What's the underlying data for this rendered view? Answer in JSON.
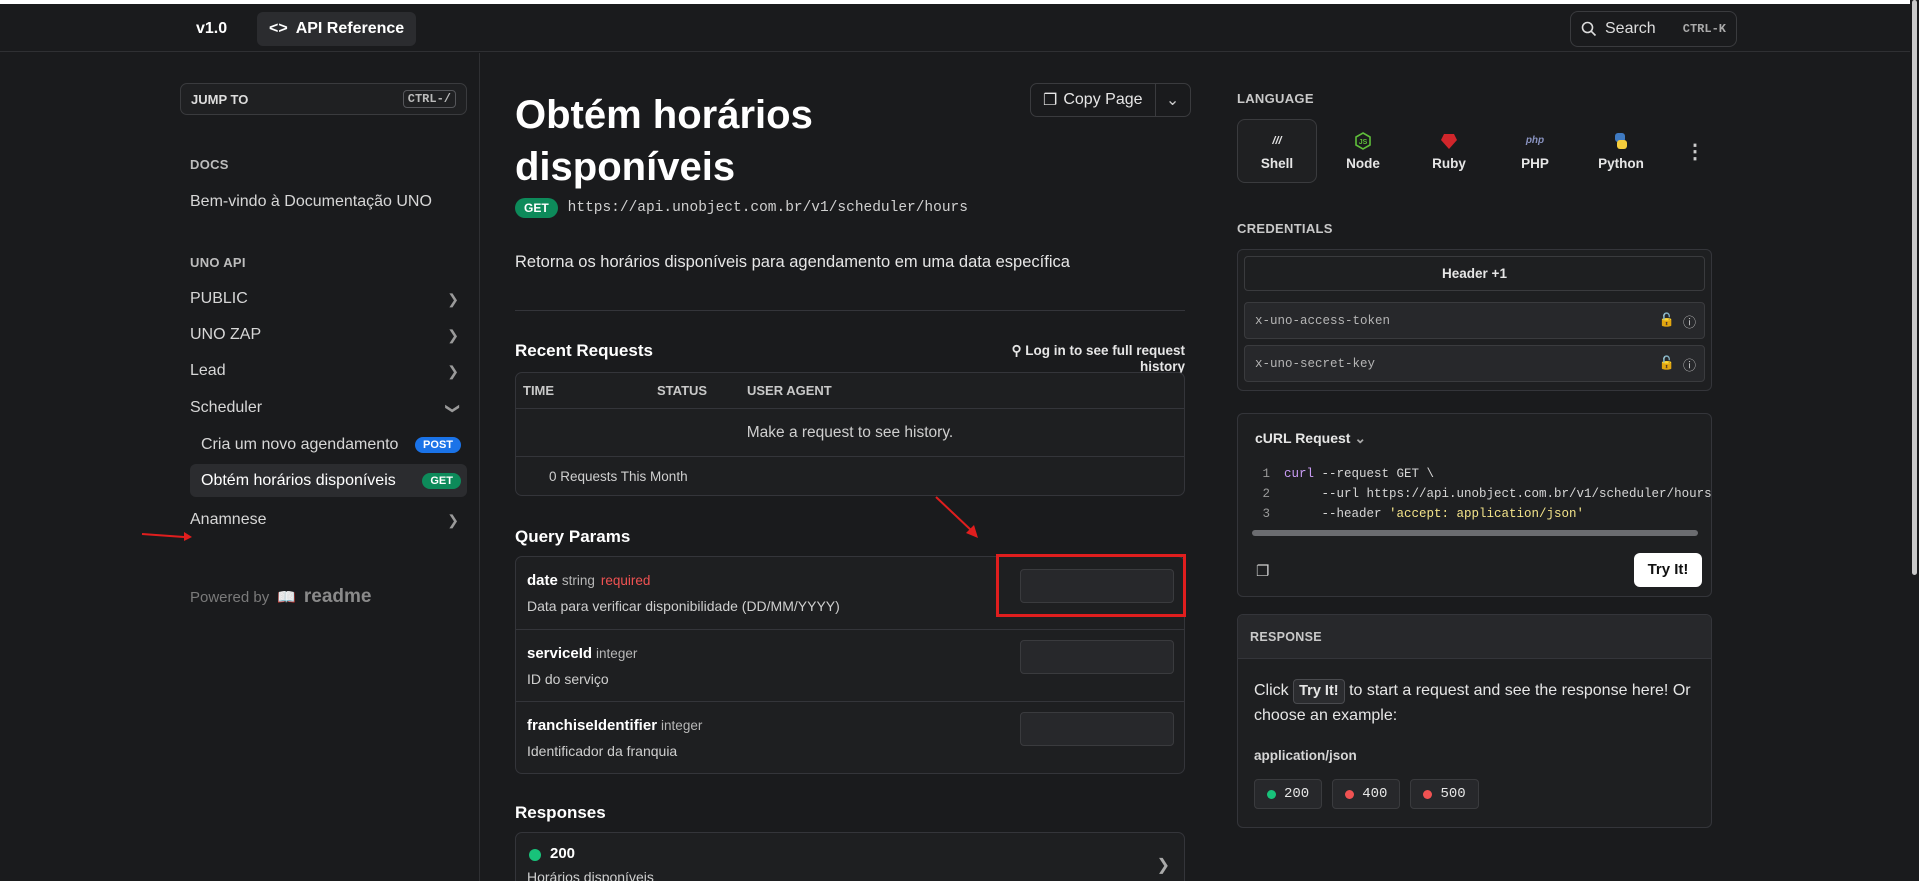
{
  "topbar": {
    "version": "v1.0",
    "api_reference": "API Reference",
    "search_label": "Search",
    "search_shortcut": "CTRL-K"
  },
  "sidebar": {
    "jump_to": "JUMP TO",
    "jump_shortcut": "CTRL-/",
    "docs_label": "DOCS",
    "docs_items": [
      "Bem-vindo à Documentação UNO"
    ],
    "api_label": "UNO API",
    "groups": [
      {
        "label": "PUBLIC"
      },
      {
        "label": "UNO ZAP"
      },
      {
        "label": "Lead"
      },
      {
        "label": "Scheduler"
      },
      {
        "label": "Anamnese"
      }
    ],
    "scheduler_items": [
      {
        "label": "Cria um novo agendamento",
        "method": "POST"
      },
      {
        "label": "Obtém horários disponíveis",
        "method": "GET"
      }
    ],
    "powered_by": "Powered by",
    "powered_brand": "readme"
  },
  "page": {
    "title": "Obtém horários disponíveis",
    "copy_page": "Copy Page",
    "method": "GET",
    "url": "https://api.unobject.com.br/v1/scheduler/hours",
    "description": "Retorna os horários disponíveis para agendamento em uma data específica"
  },
  "recent_requests": {
    "heading": "Recent Requests",
    "login_link": "Log in to see full request history",
    "columns": [
      "TIME",
      "STATUS",
      "USER AGENT"
    ],
    "empty_text": "Make a request to see history.",
    "footer": "0 Requests This Month"
  },
  "query_params": {
    "heading": "Query Params",
    "params": [
      {
        "name": "date",
        "type": "string",
        "required": "required",
        "description": "Data para verificar disponibilidade (DD/MM/YYYY)"
      },
      {
        "name": "serviceId",
        "type": "integer",
        "required": "",
        "description": "ID do serviço"
      },
      {
        "name": "franchiseIdentifier",
        "type": "integer",
        "required": "",
        "description": "Identificador da franquia"
      }
    ]
  },
  "responses": {
    "heading": "Responses",
    "items": [
      {
        "code": "200",
        "description": "Horários disponíveis"
      }
    ]
  },
  "right_panel": {
    "language_label": "LANGUAGE",
    "languages": [
      "Shell",
      "Node",
      "Ruby",
      "PHP",
      "Python"
    ],
    "selected_language": "Shell",
    "credentials_label": "CREDENTIALS",
    "credentials_header": "Header +1",
    "credential_fields": [
      "x-uno-access-token",
      "x-uno-secret-key"
    ],
    "curl_title": "cURL Request",
    "code_lines": [
      {
        "n": "1",
        "a": "curl",
        "b": " --request GET \\"
      },
      {
        "n": "2",
        "a": "",
        "b": "     --url https://api.unobject.com.br/v1/scheduler/hours"
      },
      {
        "n": "3",
        "a": "",
        "b": "     --header ",
        "s": "'accept: application/json'"
      }
    ],
    "try_it": "Try It!",
    "response_label": "RESPONSE",
    "response_text_1": "Click",
    "response_text_btn": "Try It!",
    "response_text_2": "to start a request and see the response here! Or choose an example:",
    "mime": "application/json",
    "examples": [
      {
        "code": "200",
        "color": "#18c27a"
      },
      {
        "code": "400",
        "color": "#f05252"
      },
      {
        "code": "500",
        "color": "#f05252"
      }
    ]
  },
  "colors": {
    "accent_get": "#0d8a5a",
    "accent_post": "#1a73e8",
    "highlight": "#e01e1e"
  }
}
